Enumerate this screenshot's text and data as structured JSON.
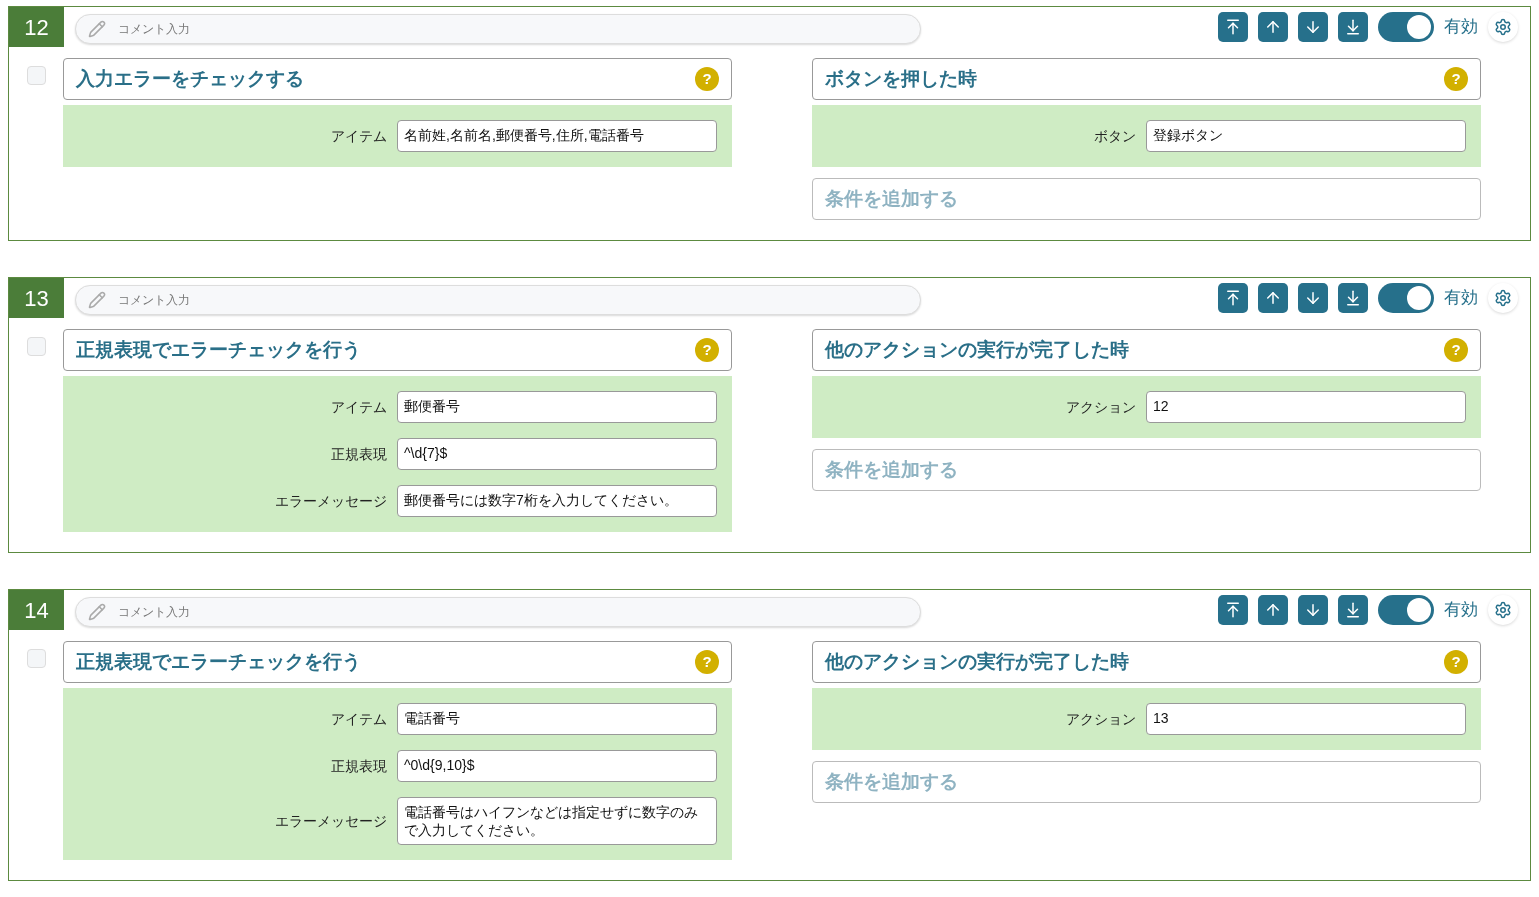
{
  "rules": [
    {
      "number": "12",
      "comment_placeholder": "コメント入力",
      "checked": false,
      "enabled": true,
      "enabled_label": "有効",
      "action": {
        "title": "入力エラーをチェックする",
        "help": "?",
        "fields": [
          {
            "label": "アイテム",
            "value": "名前姓,名前名,郵便番号,住所,電話番号"
          }
        ]
      },
      "trigger": {
        "title": "ボタンを押した時",
        "help": "?",
        "fields": [
          {
            "label": "ボタン",
            "value": "登録ボタン"
          }
        ]
      },
      "add_condition": "条件を追加する"
    },
    {
      "number": "13",
      "comment_placeholder": "コメント入力",
      "checked": false,
      "enabled": true,
      "enabled_label": "有効",
      "action": {
        "title": "正規表現でエラーチェックを行う",
        "help": "?",
        "fields": [
          {
            "label": "アイテム",
            "value": "郵便番号"
          },
          {
            "label": "正規表現",
            "value": "^\\d{7}$"
          },
          {
            "label": "エラーメッセージ",
            "value": "郵便番号には数字7桁を入力してください。"
          }
        ]
      },
      "trigger": {
        "title": "他のアクションの実行が完了した時",
        "help": "?",
        "fields": [
          {
            "label": "アクション",
            "value": "12"
          }
        ]
      },
      "add_condition": "条件を追加する"
    },
    {
      "number": "14",
      "comment_placeholder": "コメント入力",
      "checked": false,
      "enabled": true,
      "enabled_label": "有効",
      "action": {
        "title": "正規表現でエラーチェックを行う",
        "help": "?",
        "fields": [
          {
            "label": "アイテム",
            "value": "電話番号"
          },
          {
            "label": "正規表現",
            "value": "^0\\d{9,10}$"
          },
          {
            "label": "エラーメッセージ",
            "value": "電話番号はハイフンなどは指定せずに数字のみで入力してください。"
          }
        ]
      },
      "trigger": {
        "title": "他のアクションの実行が完了した時",
        "help": "?",
        "fields": [
          {
            "label": "アクション",
            "value": "13"
          }
        ]
      },
      "add_condition": "条件を追加する"
    }
  ]
}
